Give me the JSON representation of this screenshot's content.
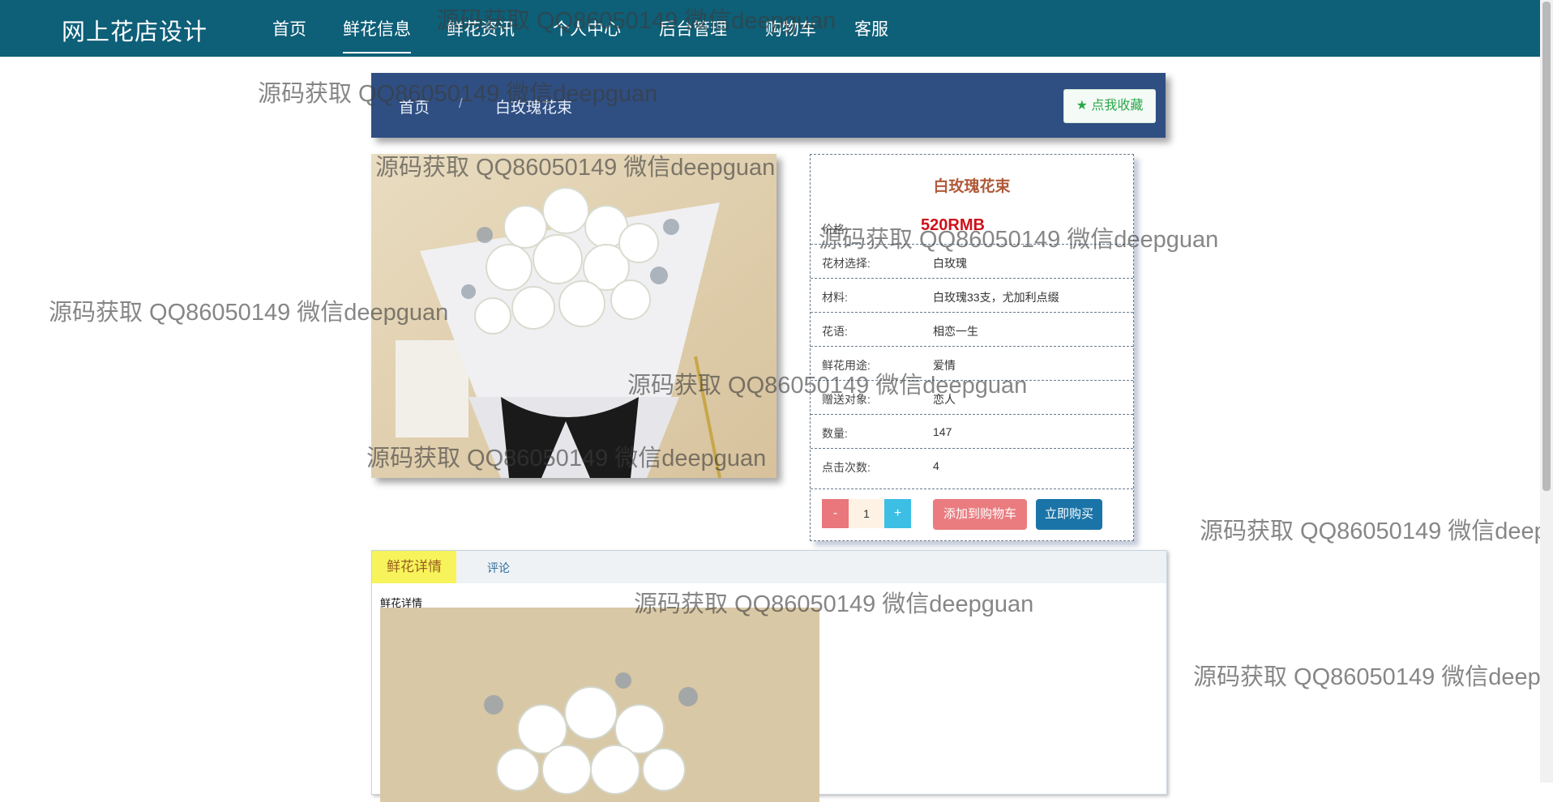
{
  "nav": {
    "brand": "网上花店设计",
    "items": [
      {
        "label": "首页"
      },
      {
        "label": "鲜花信息"
      },
      {
        "label": "鲜花资讯"
      },
      {
        "label": "个人中心"
      },
      {
        "label": "后台管理"
      },
      {
        "label": "购物车"
      },
      {
        "label": "客服"
      }
    ],
    "active_item": "鲜花信息"
  },
  "breadcrumb": {
    "home": "首页",
    "separator": "/",
    "current": "白玫瑰花束",
    "favorite_label": "点我收藏"
  },
  "product": {
    "title": "白玫瑰花束",
    "price_label": "价格:",
    "price_value": "520RMB",
    "rows": [
      {
        "label": "花材选择:",
        "value": "白玫瑰"
      },
      {
        "label": "材料:",
        "value": "白玫瑰33支，尤加利点缀"
      },
      {
        "label": "花语:",
        "value": "相恋一生"
      },
      {
        "label": "鲜花用途:",
        "value": "爱情"
      },
      {
        "label": "赠送对象:",
        "value": "恋人"
      },
      {
        "label": "数量:",
        "value": "147"
      },
      {
        "label": "点击次数:",
        "value": "4"
      }
    ],
    "quantity": "1",
    "minus_label": "-",
    "plus_label": "+",
    "add_cart_label": "添加到购物车",
    "buy_now_label": "立即购买"
  },
  "tabs": {
    "items": [
      {
        "label": "鲜花详情"
      },
      {
        "label": "评论"
      }
    ],
    "content_title": "鲜花详情"
  },
  "watermark": "源码获取 QQ86050149 微信deepguan",
  "colors": {
    "navbar": "#0e5f78",
    "breadcrumb": "#2f4f82",
    "price": "#d0101a",
    "title": "#b05a3a",
    "tab_active": "#f6f45a"
  }
}
